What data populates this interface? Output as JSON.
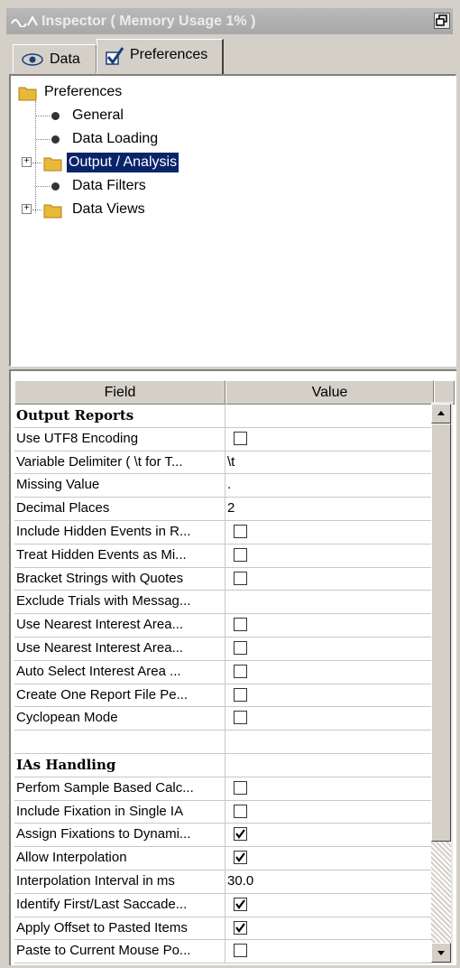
{
  "window": {
    "title": "Inspector ( Memory Usage 1% )"
  },
  "tabs": [
    {
      "label": "Data"
    },
    {
      "label": "Preferences"
    }
  ],
  "tree": {
    "root": "Preferences",
    "items": [
      {
        "label": "General"
      },
      {
        "label": "Data Loading"
      },
      {
        "label": "Output / Analysis",
        "selected": true
      },
      {
        "label": "Data Filters"
      },
      {
        "label": "Data Views"
      }
    ]
  },
  "grid": {
    "columns": {
      "field": "Field",
      "value": "Value"
    },
    "rows": [
      {
        "field": "Output Reports",
        "type": "section"
      },
      {
        "field": "Use UTF8 Encoding",
        "type": "check",
        "checked": false
      },
      {
        "field": "Variable Delimiter ( \\t for T...",
        "type": "text",
        "value": "\\t"
      },
      {
        "field": "Missing Value",
        "type": "text",
        "value": "."
      },
      {
        "field": "Decimal Places",
        "type": "text",
        "value": "2"
      },
      {
        "field": "Include Hidden Events in R...",
        "type": "check",
        "checked": false
      },
      {
        "field": "Treat Hidden Events as Mi...",
        "type": "check",
        "checked": false
      },
      {
        "field": "Bracket Strings with Quotes",
        "type": "check",
        "checked": false
      },
      {
        "field": "Exclude Trials with Messag...",
        "type": "text",
        "value": ""
      },
      {
        "field": "Use Nearest Interest Area...",
        "type": "check",
        "checked": false
      },
      {
        "field": "Use Nearest Interest Area...",
        "type": "check",
        "checked": false
      },
      {
        "field": "Auto Select Interest Area ...",
        "type": "check",
        "checked": false
      },
      {
        "field": "Create One Report File Pe...",
        "type": "check",
        "checked": false
      },
      {
        "field": "Cyclopean Mode",
        "type": "check",
        "checked": false
      },
      {
        "field": "",
        "type": "blank"
      },
      {
        "field": "IAs Handling",
        "type": "section"
      },
      {
        "field": "Perfom Sample Based Calc...",
        "type": "check",
        "checked": false
      },
      {
        "field": "Include Fixation in Single IA",
        "type": "check",
        "checked": false
      },
      {
        "field": "Assign Fixations to Dynami...",
        "type": "check",
        "checked": true
      },
      {
        "field": "Allow Interpolation",
        "type": "check",
        "checked": true
      },
      {
        "field": "Interpolation Interval in ms",
        "type": "text",
        "value": "30.0"
      },
      {
        "field": "Identify First/Last Saccade...",
        "type": "check",
        "checked": true
      },
      {
        "field": "Apply Offset to Pasted Items",
        "type": "check",
        "checked": true
      },
      {
        "field": "Paste to Current Mouse Po...",
        "type": "check",
        "checked": false
      }
    ]
  }
}
